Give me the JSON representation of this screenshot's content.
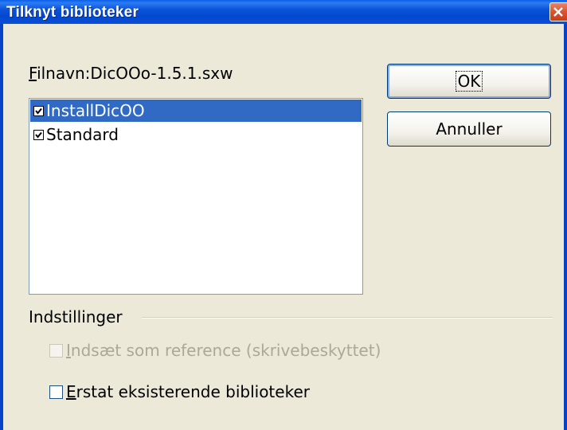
{
  "window": {
    "title": "Tilknyt biblioteker"
  },
  "filename": {
    "mnemonic": "F",
    "label": "ilnavn:DicOOo-1.5.1.sxw"
  },
  "libraries": [
    {
      "label": "InstallDicOO",
      "checked": true,
      "selected": true
    },
    {
      "label": "Standard",
      "checked": true,
      "selected": false
    }
  ],
  "buttons": {
    "ok": "OK",
    "cancel": "Annuller"
  },
  "options": {
    "group_label": "Indstillinger",
    "insert_as_reference": {
      "mnemonic": "I",
      "label": "ndsæt som reference (skrivebeskyttet)",
      "checked": false,
      "enabled": false
    },
    "replace_existing": {
      "mnemonic": "E",
      "label": "rstat eksisterende biblioteker",
      "checked": false,
      "enabled": true
    }
  },
  "colors": {
    "titlebar": "#0a53d9",
    "selection": "#316ac5",
    "dialog_bg": "#ece9d8"
  }
}
